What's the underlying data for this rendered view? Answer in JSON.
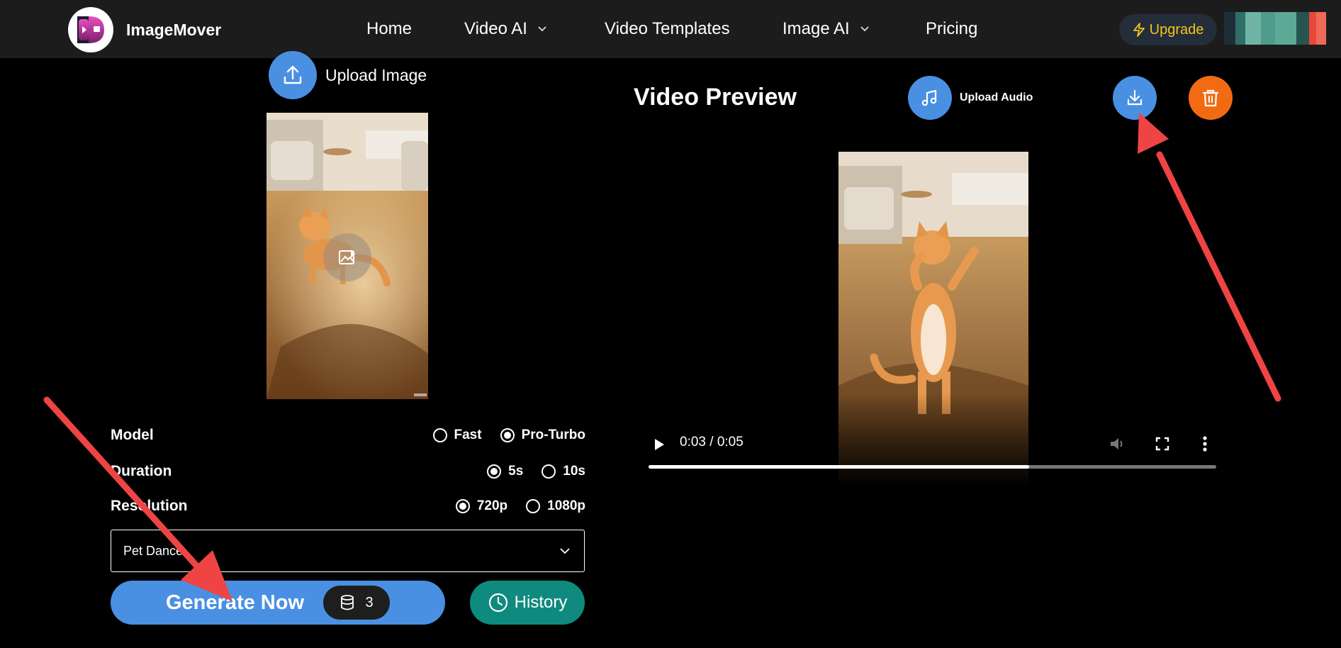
{
  "header": {
    "brand": "ImageMover",
    "nav": [
      {
        "label": "Home",
        "dropdown": false
      },
      {
        "label": "Video AI",
        "dropdown": true
      },
      {
        "label": "Video Templates",
        "dropdown": false
      },
      {
        "label": "Image AI",
        "dropdown": true
      },
      {
        "label": "Pricing",
        "dropdown": false
      }
    ],
    "upgrade_label": "Upgrade",
    "upgrade_color": "#f5c518"
  },
  "left": {
    "upload_label": "Upload Image",
    "options": {
      "model": {
        "label": "Model",
        "choices": [
          "Fast",
          "Pro-Turbo"
        ],
        "selected": "Pro-Turbo"
      },
      "duration": {
        "label": "Duration",
        "choices": [
          "5s",
          "10s"
        ],
        "selected": "5s"
      },
      "resolution": {
        "label": "Resolution",
        "choices": [
          "720p",
          "1080p"
        ],
        "selected": "720p"
      }
    },
    "template_value": "Pet Dance",
    "generate_label": "Generate Now",
    "credits": "3",
    "history_label": "History"
  },
  "right": {
    "title": "Video Preview",
    "upload_audio_label": "Upload Audio",
    "video": {
      "time": "0:03 / 0:05",
      "progress": 0.67
    }
  },
  "colors": {
    "primary_blue": "#4a90e2",
    "history_teal": "#0f8a7e",
    "delete_orange": "#f26b13",
    "annotation_red": "#ee4444"
  },
  "icons": [
    "play-icon",
    "upload-icon",
    "music-icon",
    "download-icon",
    "trash-icon",
    "database-icon",
    "clock-icon",
    "lightning-icon",
    "chevron-down-icon",
    "volume-icon",
    "fullscreen-icon",
    "more-icon",
    "image-edit-icon"
  ]
}
